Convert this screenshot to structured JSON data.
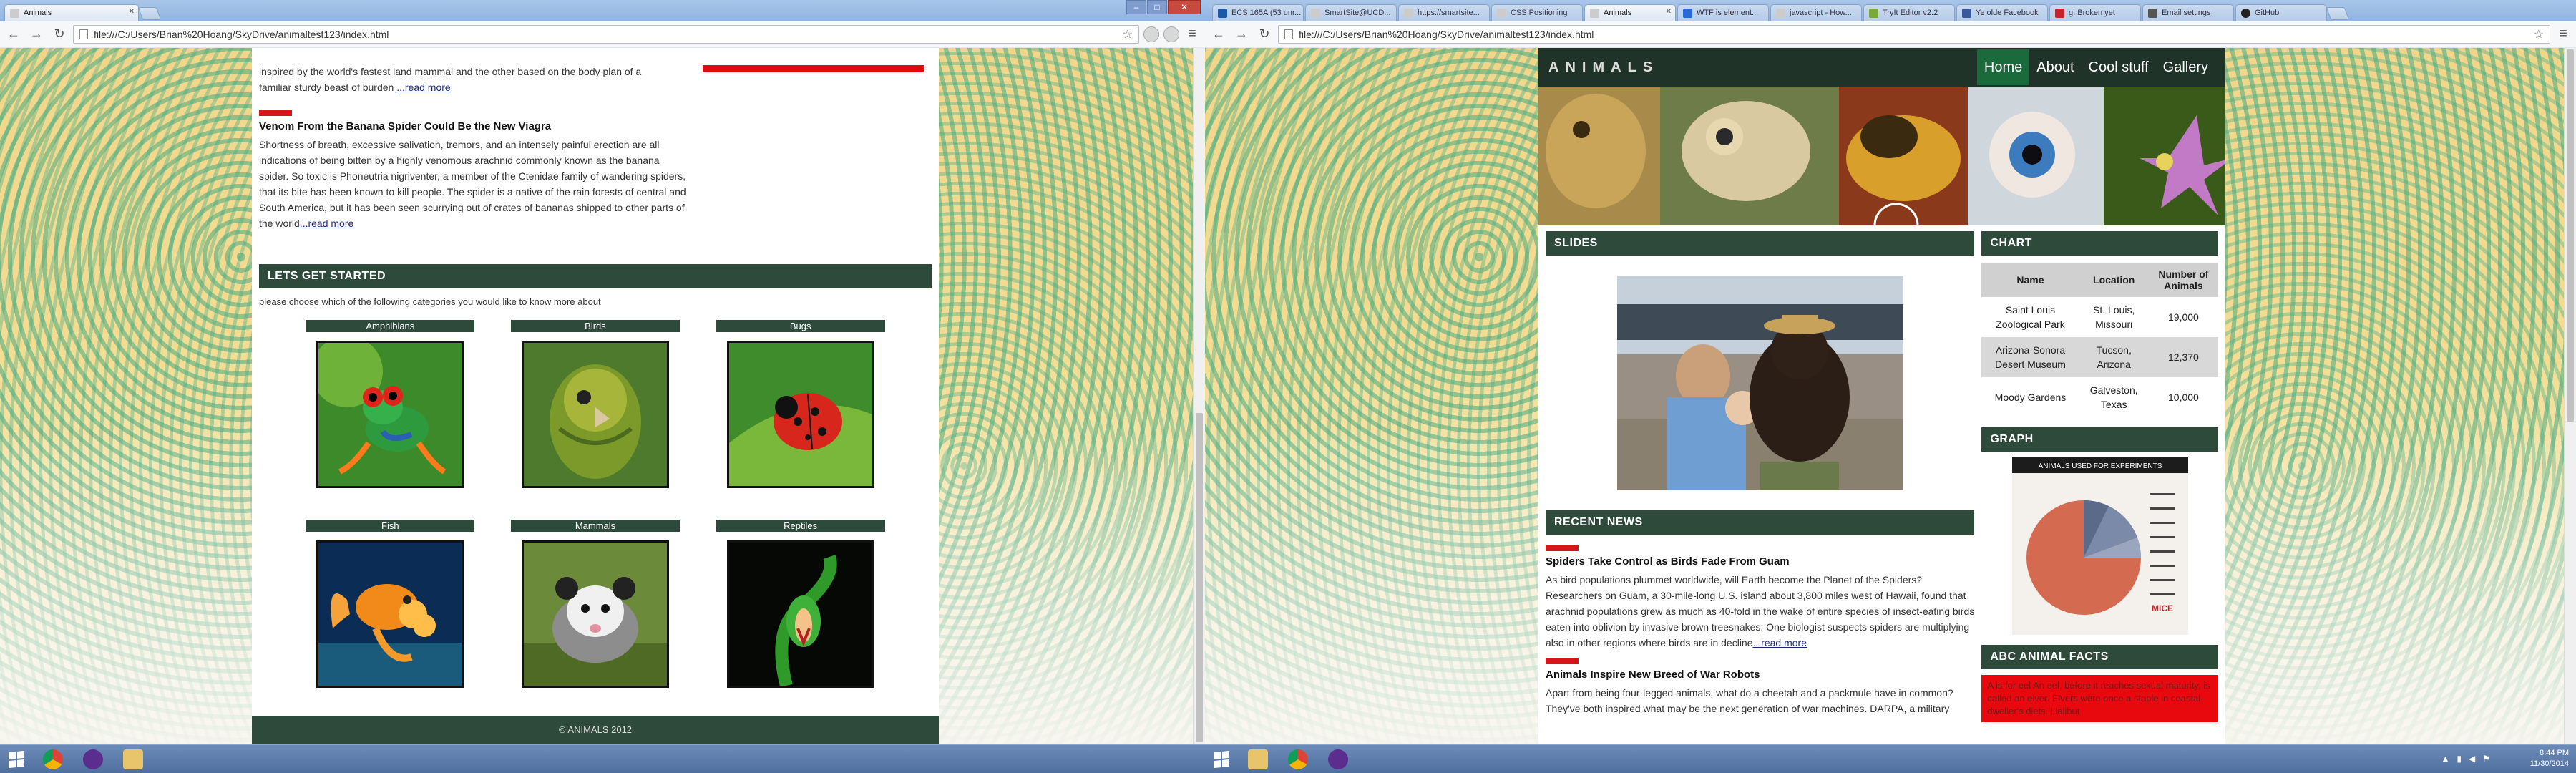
{
  "left": {
    "tab_title": "Animals",
    "url": "file:///C:/Users/Brian%20Hoang/SkyDrive/animaltest123/index.html",
    "news_top_fragment_1": "inspired by the world's fastest land mammal and the other based on the body plan of a",
    "news_top_fragment_2": "familiar sturdy beast of burden",
    "read_more": "...read more",
    "article_title": "Venom From the Banana Spider Could Be the New Viagra",
    "article_body": "Shortness of breath, excessive salivation, tremors, and an intensely painful erection are all indications of being bitten by a highly venomous arachnid commonly known as the banana spider. So toxic is Phoneutria nigriventer, a member of the Ctenidae family of wandering spiders, that its bite has been known to kill people. The spider is a native of the rain forests of central and South America, but it has been seen scurrying out of crates of bananas shipped to other parts of the world",
    "section_header": "LETS GET STARTED",
    "intro": "please choose which of the following categories you would like to know more about",
    "categories": [
      "Amphibians",
      "Birds",
      "Bugs",
      "Fish",
      "Mammals",
      "Reptiles"
    ],
    "footer": "© ANIMALS 2012"
  },
  "right": {
    "tabs": [
      "ECS 165A (53 unr...",
      "SmartSite@UCD...",
      "https://smartsite...",
      "CSS Positioning",
      "Animals",
      "WTF is element...",
      "javascript - How...",
      "TryIt Editor v2.2",
      "Ye olde Facebook",
      "g: Broken yet",
      "Email settings",
      "GitHub"
    ],
    "url": "file:///C:/Users/Brian%20Hoang/SkyDrive/animaltest123/index.html",
    "logo": "ANIMALS",
    "nav": [
      "Home",
      "About",
      "Cool stuff",
      "Gallery"
    ],
    "slides_header": "SLIDES",
    "chart_header": "CHART",
    "table": {
      "headers": [
        "Name",
        "Location",
        "Number of Animals"
      ],
      "rows": [
        [
          "Saint Louis Zoological Park",
          "St. Louis, Missouri",
          "19,000"
        ],
        [
          "Arizona-Sonora Desert Museum",
          "Tucson, Arizona",
          "12,370"
        ],
        [
          "Moody Gardens",
          "Galveston, Texas",
          "10,000"
        ]
      ]
    },
    "graph_header": "GRAPH",
    "graph_title": "ANIMALS USED FOR EXPERIMENTS",
    "graph_label": "MICE",
    "recent_header": "RECENT NEWS",
    "news": [
      {
        "title": "Spiders Take Control as Birds Fade From Guam",
        "body": "As bird populations plummet worldwide, will Earth become the Planet of the Spiders? Researchers on Guam, a 30-mile-long U.S. island about 3,800 miles west of Hawaii, found that arachnid populations grew as much as 40-fold in the wake of entire species of insect-eating birds eaten into oblivion by invasive brown treesnakes. One biologist suspects spiders are multiplying also in other regions where birds are in decline",
        "more": "...read more"
      },
      {
        "title": "Animals Inspire New Breed of War Robots",
        "body": "Apart from being four-legged animals, what do a cheetah and a packmule have in common? They've both inspired what may be the next generation of war machines. DARPA, a military",
        "more": ""
      }
    ],
    "abc_header": "ABC ANIMAL FACTS",
    "abc_text": "A is for eel An eel, before it reaches sexual maturity, is called an elver. Elvers were once a staple in coastal-dweller's diets. Halibut",
    "clock_time": "8:44 PM",
    "clock_date": "11/30/2014"
  },
  "colors": {
    "site_dark": "#2e4a3b",
    "red": "#d8161a",
    "nav": "#1f3328",
    "active_nav": "#1b6a3b"
  }
}
